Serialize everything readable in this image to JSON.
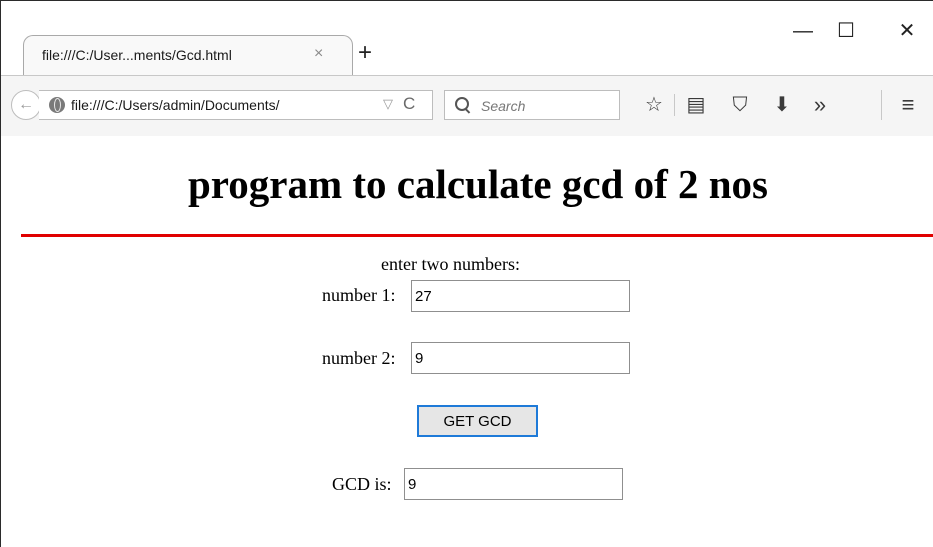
{
  "browser": {
    "tab": {
      "title": "file:///C:/User...ments/Gcd.html",
      "close_glyph": "×"
    },
    "new_tab_glyph": "+",
    "window_controls": {
      "minimize_glyph": "—",
      "maximize_glyph": "☐",
      "close_glyph": "✕"
    },
    "toolbar": {
      "back_glyph": "←",
      "url": "file:///C:/Users/admin/Documents/",
      "url_dropdown_glyph": "▽",
      "reload_glyph": "C",
      "search_placeholder": "Search",
      "icons": {
        "star": "☆",
        "reading_list": "▤",
        "pocket": "⛉",
        "download": "⬇",
        "overflow": "»",
        "menu": "≡"
      }
    }
  },
  "page": {
    "title": "program to calculate gcd of 2 nos",
    "rule_color": "#e00000",
    "prompt": "enter two numbers:",
    "number1_label": "number 1:",
    "number1_value": "27",
    "number2_label": "number 2:",
    "number2_value": "9",
    "button_label": "GET GCD",
    "result_label": "GCD is:",
    "result_value": "9"
  }
}
